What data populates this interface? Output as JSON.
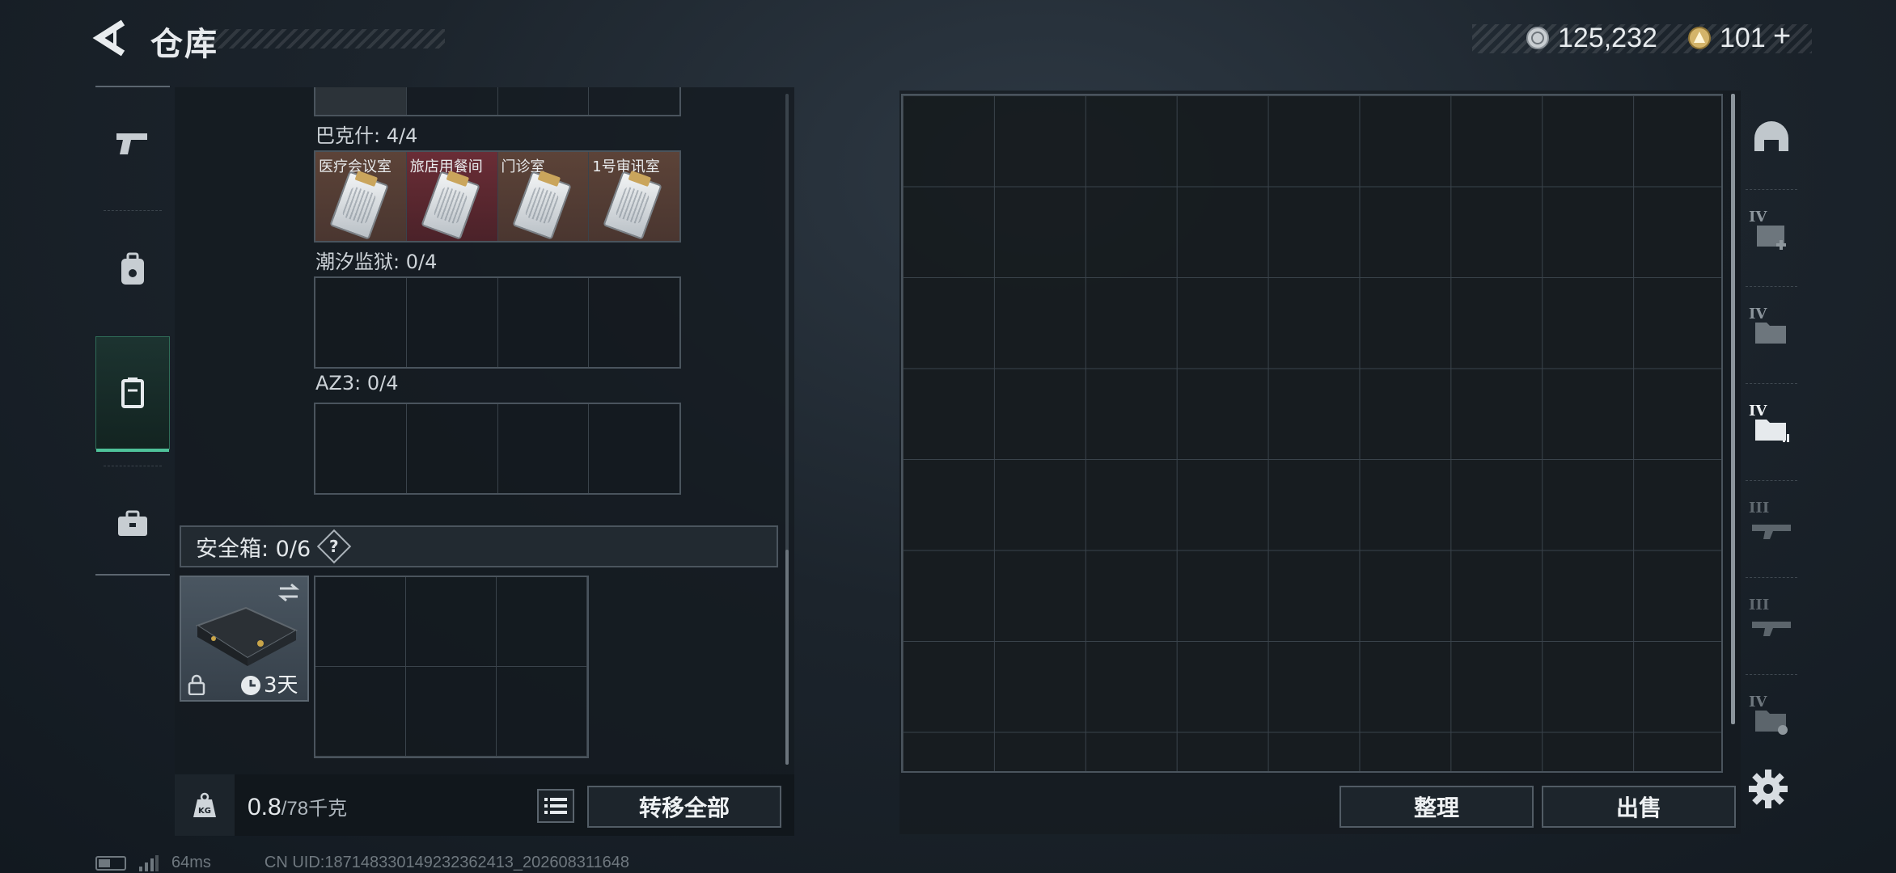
{
  "header": {
    "title": "仓库",
    "currency_silver": "125,232",
    "currency_gold": "101",
    "plus": "+"
  },
  "left_tabs": [
    {
      "name": "weapons",
      "icon": "pistol-icon",
      "active": false
    },
    {
      "name": "armor",
      "icon": "backpack-icon",
      "active": false
    },
    {
      "name": "keys",
      "icon": "keycard-holder-icon",
      "active": true
    },
    {
      "name": "items",
      "icon": "briefcase-icon",
      "active": false
    }
  ],
  "key_sections": [
    {
      "label": "巴克什: 4/4",
      "slots": [
        {
          "name": "医疗会议室",
          "filled": true,
          "color": "brown"
        },
        {
          "name": "旅店用餐间",
          "filled": true,
          "color": "red"
        },
        {
          "name": "门诊室",
          "filled": true,
          "color": "brown"
        },
        {
          "name": "1号审讯室",
          "filled": true,
          "color": "brown"
        }
      ]
    },
    {
      "label": "潮汐监狱: 0/4",
      "slots": [
        {
          "filled": false
        },
        {
          "filled": false
        },
        {
          "filled": false
        },
        {
          "filled": false
        }
      ]
    },
    {
      "label": "AZ3: 0/4",
      "slots": [
        {
          "filled": false
        },
        {
          "filled": false
        },
        {
          "filled": false
        },
        {
          "filled": false
        }
      ]
    }
  ],
  "safebox": {
    "label": "安全箱: 0/6",
    "help": "?",
    "timer": "3天"
  },
  "weight": {
    "current": "0.8",
    "max": "/78千克",
    "unit_badge": "KG"
  },
  "buttons": {
    "transfer_all": "转移全部",
    "sort": "整理",
    "sell": "出售"
  },
  "right_tabs": [
    {
      "icon": "helmet-icon",
      "tier": ""
    },
    {
      "icon": "medkit-folder-icon",
      "tier": "IV"
    },
    {
      "icon": "folder-icon",
      "tier": "IV"
    },
    {
      "icon": "folder-active-icon",
      "tier": "IV"
    },
    {
      "icon": "rifle-icon",
      "tier": "III"
    },
    {
      "icon": "rifle-icon",
      "tier": "III"
    },
    {
      "icon": "folder-gear-icon",
      "tier": "IV"
    }
  ],
  "status": {
    "ping": "64ms",
    "uid": "CN UID:18714833014923236​2413_202608311648"
  }
}
